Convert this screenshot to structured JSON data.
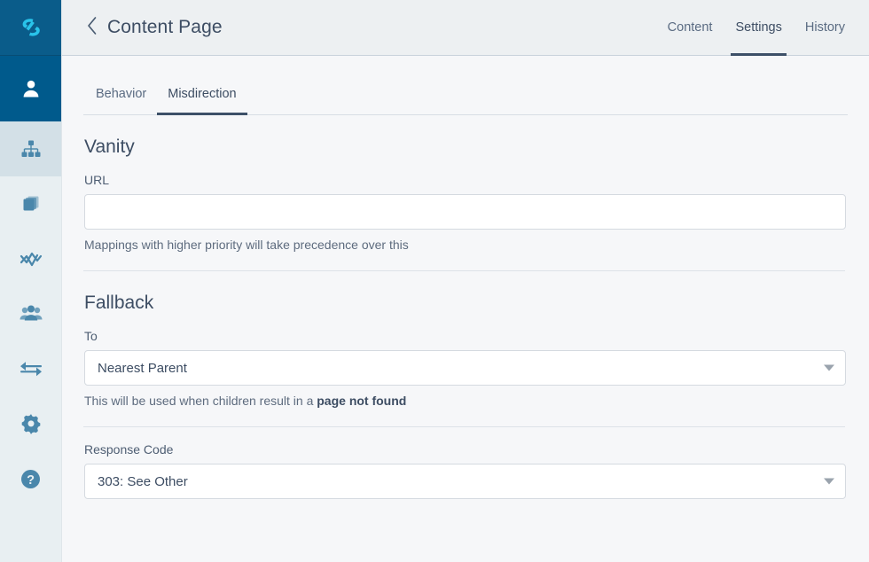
{
  "theme": {
    "logo_color": "#29c3ea",
    "sidebar_bg": "#e8eff2",
    "sidebar_logo_bg": "#0a5c8a",
    "sidebar_user_bg": "#005a8c",
    "sidebar_active_bg": "#d3e0e7",
    "icon_color": "#4a87ab",
    "accent_underline": "#3d5068",
    "header_bg": "#edf0f2",
    "content_bg": "#f6f7f9",
    "text_color": "#3d4d63"
  },
  "sidebar": {
    "logo": {
      "name": "app-logo",
      "icon": "s-curve-logo-icon"
    },
    "items": [
      {
        "id": "user",
        "icon": "user-icon",
        "label": "User",
        "state": "highlighted"
      },
      {
        "id": "sitemap",
        "icon": "sitemap-icon",
        "label": "Site Tree",
        "state": "active"
      },
      {
        "id": "pages",
        "icon": "layers-icon",
        "label": "Pages",
        "state": "default"
      },
      {
        "id": "analytics",
        "icon": "line-chart-icon",
        "label": "Analytics",
        "state": "default"
      },
      {
        "id": "audiences",
        "icon": "users-icon",
        "label": "Audiences",
        "state": "default"
      },
      {
        "id": "redirects",
        "icon": "exchange-icon",
        "label": "Redirects",
        "state": "default"
      },
      {
        "id": "settings",
        "icon": "gear-icon",
        "label": "Settings",
        "state": "default"
      },
      {
        "id": "help",
        "icon": "help-circle-icon",
        "label": "Help",
        "state": "default"
      }
    ]
  },
  "header": {
    "back_icon": "chevron-left-icon",
    "title": "Content Page",
    "nav": [
      {
        "label": "Content",
        "active": false
      },
      {
        "label": "Settings",
        "active": true
      },
      {
        "label": "History",
        "active": false
      }
    ]
  },
  "subtabs": [
    {
      "label": "Behavior",
      "active": false
    },
    {
      "label": "Misdirection",
      "active": true
    }
  ],
  "sections": {
    "vanity": {
      "title": "Vanity",
      "url_field": {
        "label": "URL",
        "value": "",
        "placeholder": "",
        "hint": "Mappings with higher priority will take precedence over this"
      }
    },
    "fallback": {
      "title": "Fallback",
      "to_field": {
        "label": "To",
        "value": "Nearest Parent",
        "hint_prefix": "This will be used when children result in a ",
        "hint_strong": "page not found",
        "caret_icon": "chevron-down-icon"
      },
      "response_code_field": {
        "label": "Response Code",
        "value": "303: See Other",
        "caret_icon": "chevron-down-icon"
      }
    }
  }
}
